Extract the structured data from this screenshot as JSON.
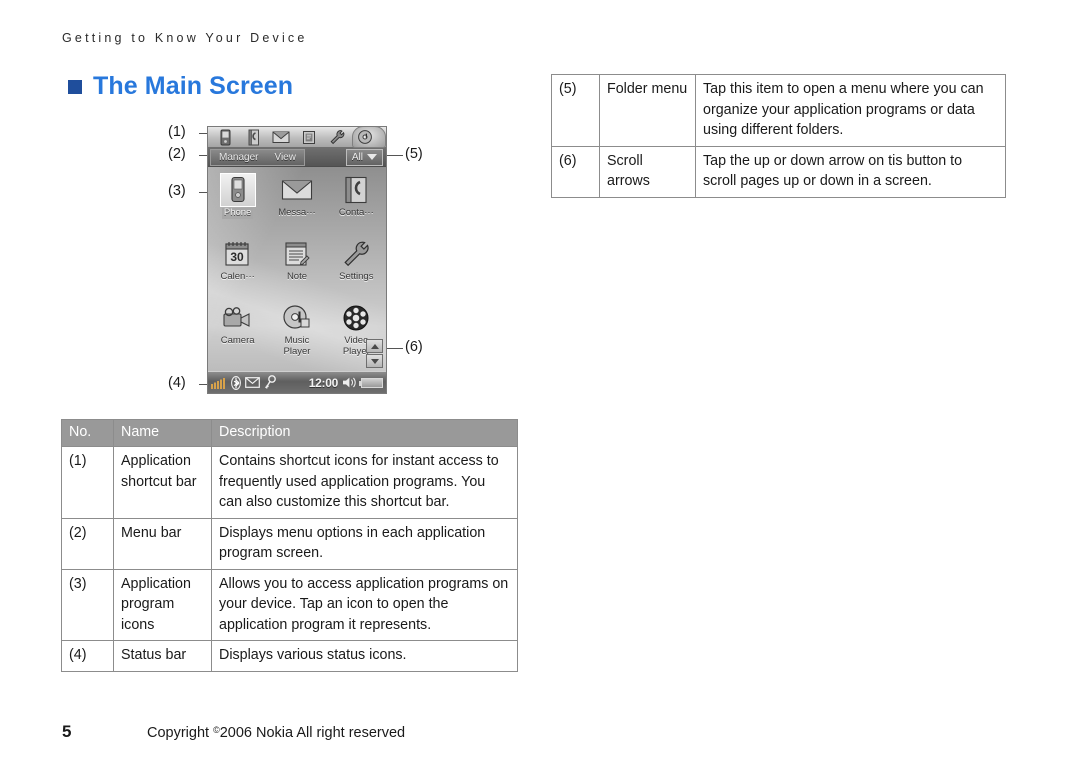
{
  "running_head": "Getting to Know Your Device",
  "heading": {
    "text": "The Main Screen",
    "bullet_color": "#1f4e9c",
    "text_color": "#2878dc"
  },
  "callouts": {
    "c1": "(1)",
    "c2": "(2)",
    "c3": "(3)",
    "c4": "(4)",
    "c5": "(5)",
    "c6": "(6)"
  },
  "device_screen": {
    "shortcut_bar_icons": [
      "phone-icon",
      "contacts-icon",
      "messaging-icon",
      "notes-icon",
      "settings-wrench-icon",
      "music-disc-icon"
    ],
    "menu_bar": {
      "items": [
        "Manager",
        "View"
      ],
      "folder_menu_label": "All",
      "folder_menu_caret": "chevron-down-icon"
    },
    "apps": [
      {
        "label": "Phone",
        "icon": "phone-icon",
        "selected": true
      },
      {
        "label": "Messa···",
        "icon": "envelope-icon",
        "selected": false
      },
      {
        "label": "Conta···",
        "icon": "contacts-icon",
        "selected": false
      },
      {
        "label": "Calen···",
        "icon": "calendar-icon",
        "selected": false
      },
      {
        "label": "Note",
        "icon": "notepad-icon",
        "selected": false
      },
      {
        "label": "Settings",
        "icon": "wrench-icon",
        "selected": false
      },
      {
        "label": "Camera",
        "icon": "camera-icon",
        "selected": false
      },
      {
        "label": "Music\nPlayer",
        "icon": "music-disc-icon",
        "selected": false
      },
      {
        "label": "Video\nPlayer",
        "icon": "film-reel-icon",
        "selected": false
      }
    ],
    "calendar_day": "30",
    "scroll": {
      "up": "scroll-up-icon",
      "down": "scroll-down-icon"
    },
    "status_bar": {
      "icons": [
        "signal-bars-icon",
        "bluetooth-icon",
        "envelope-icon",
        "key-icon",
        "speaker-icon",
        "battery-icon"
      ],
      "time": "12:00"
    }
  },
  "main_table": {
    "headers": [
      "No.",
      "Name",
      "Description"
    ],
    "rows": [
      {
        "no": "(1)",
        "name": "Application shortcut bar",
        "description": "Contains shortcut icons for instant access to frequently used application programs. You can also customize this shortcut bar."
      },
      {
        "no": "(2)",
        "name": "Menu bar",
        "description": "Displays menu options in each application program screen."
      },
      {
        "no": "(3)",
        "name": "Application program icons",
        "description": "Allows you to access application programs on your device. Tap an icon to open the application program it represents."
      },
      {
        "no": "(4)",
        "name": "Status bar",
        "description": "Displays various status icons."
      }
    ]
  },
  "top_table": {
    "rows": [
      {
        "no": "(5)",
        "name": "Folder menu",
        "description": "Tap this item to open a menu where you can organize your application programs or data using different folders."
      },
      {
        "no": "(6)",
        "name": "Scroll arrows",
        "description": "Tap the up or down arrow on tis button to scroll pages up or down in a screen."
      }
    ]
  },
  "footer": {
    "page_number": "5",
    "copyright_prefix": "Copyright ",
    "copyright_symbol": "©",
    "copyright_rest": "2006 Nokia All right reserved"
  }
}
